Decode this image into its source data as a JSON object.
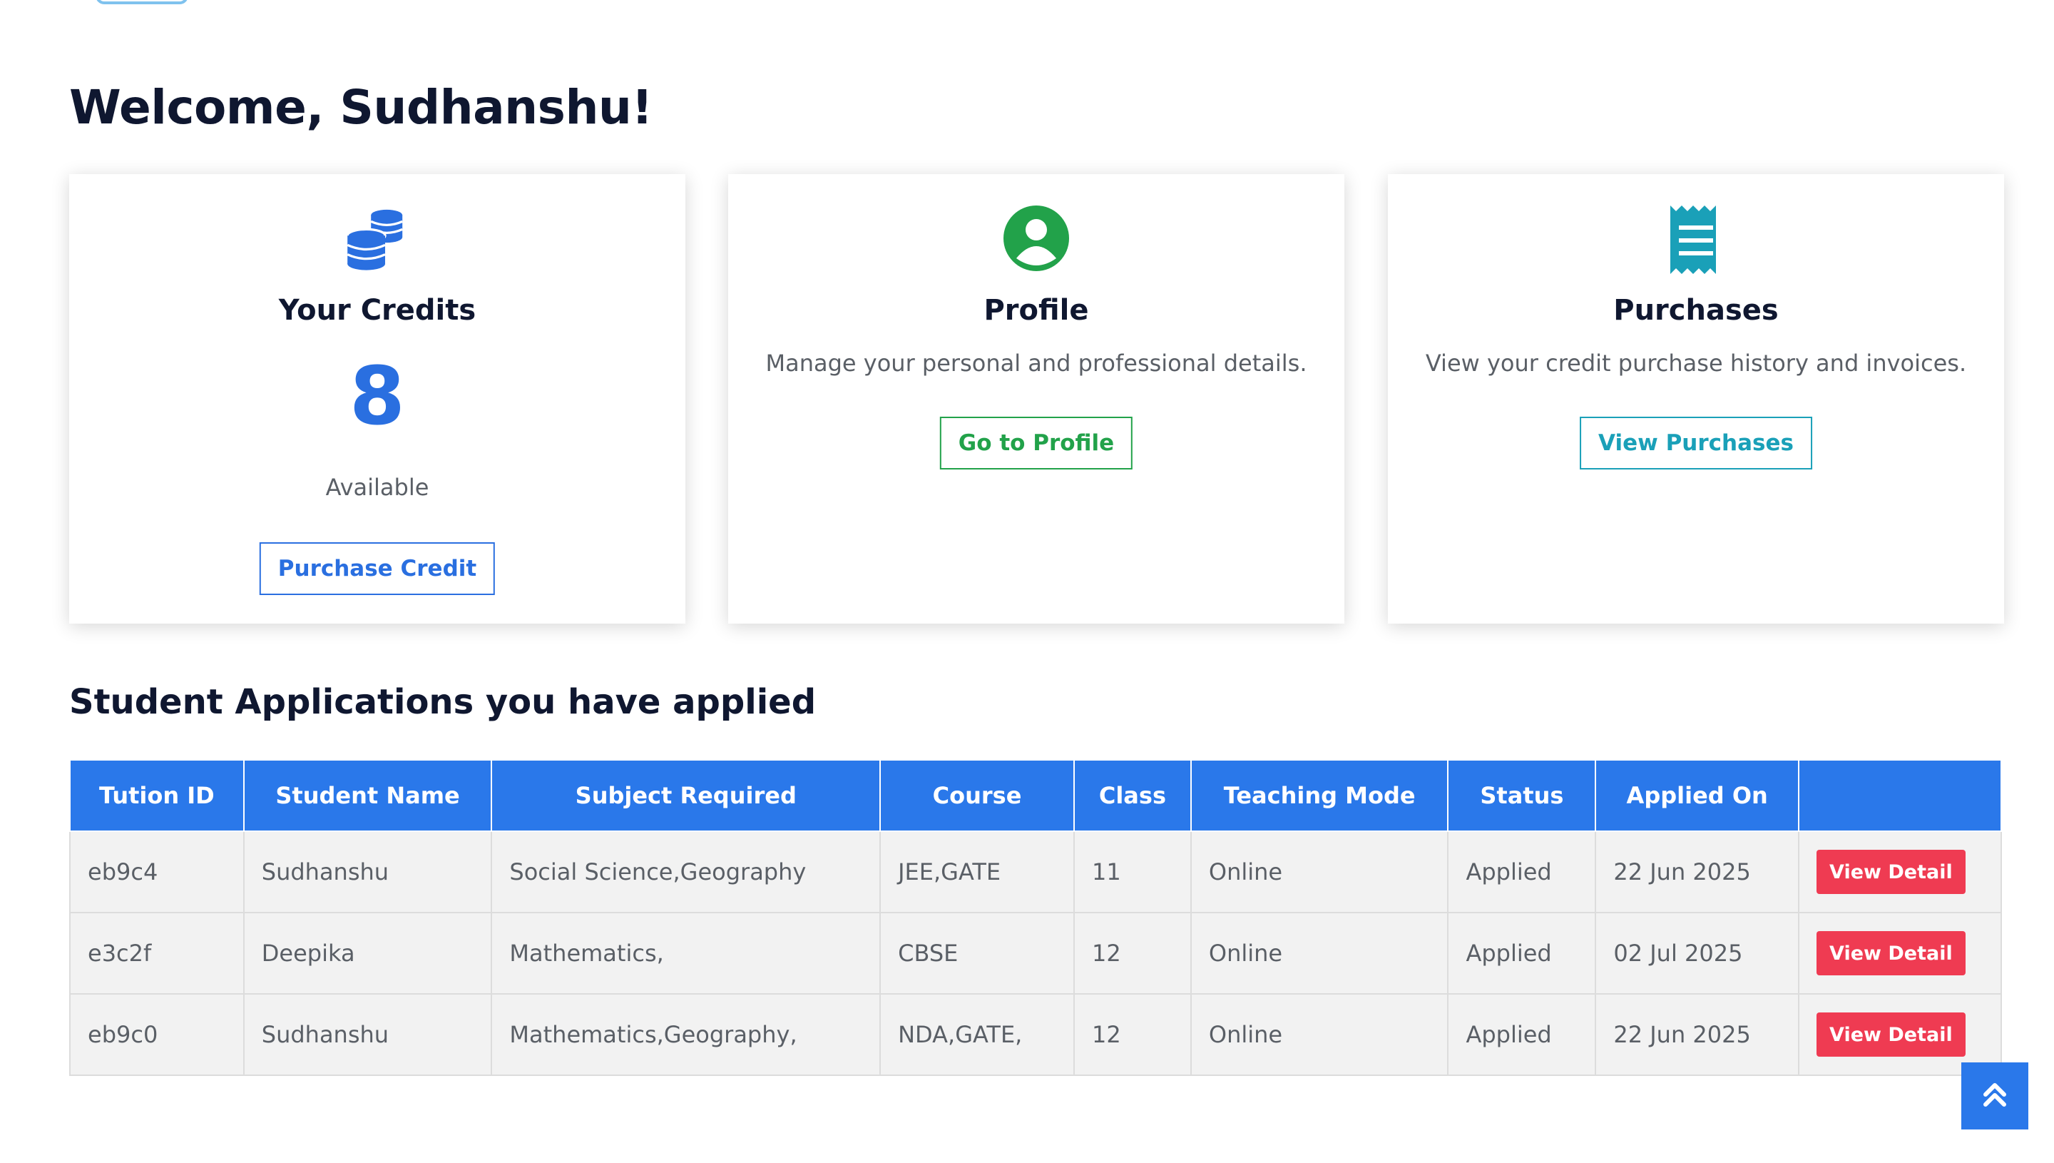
{
  "welcome": {
    "title": "Welcome, Sudhanshu!"
  },
  "cards": {
    "credits": {
      "icon": "coins-icon",
      "title": "Your Credits",
      "value": "8",
      "subtitle": "Available",
      "button": "Purchase Credit",
      "color": "#2a6fe0"
    },
    "profile": {
      "icon": "user-circle-icon",
      "title": "Profile",
      "description": "Manage your personal and professional details.",
      "button": "Go to Profile",
      "color": "#22a24a"
    },
    "purchases": {
      "icon": "receipt-icon",
      "title": "Purchases",
      "description": "View your credit purchase history and invoices.",
      "button": "View Purchases",
      "color": "#1aa0b8"
    }
  },
  "applications": {
    "title": "Student Applications you have applied",
    "columns": [
      "Tution ID",
      "Student Name",
      "Subject Required",
      "Course",
      "Class",
      "Teaching Mode",
      "Status",
      "Applied On",
      ""
    ],
    "rows": [
      {
        "id": "eb9c4",
        "name": "Sudhanshu",
        "subject": "Social Science,Geography",
        "course": "JEE,GATE",
        "class": "11",
        "mode": "Online",
        "status": "Applied",
        "applied_on": "22 Jun 2025",
        "action": "View Detail"
      },
      {
        "id": "e3c2f",
        "name": "Deepika",
        "subject": "Mathematics,",
        "course": "CBSE",
        "class": "12",
        "mode": "Online",
        "status": "Applied",
        "applied_on": "02 Jul 2025",
        "action": "View Detail"
      },
      {
        "id": "eb9c0",
        "name": "Sudhanshu",
        "subject": "Mathematics,Geography,",
        "course": "NDA,GATE,",
        "class": "12",
        "mode": "Online",
        "status": "Applied",
        "applied_on": "22 Jun 2025",
        "action": "View Detail"
      }
    ]
  },
  "scroll_top": {
    "icon": "double-chevron-up-icon",
    "color": "#2a78ea"
  }
}
